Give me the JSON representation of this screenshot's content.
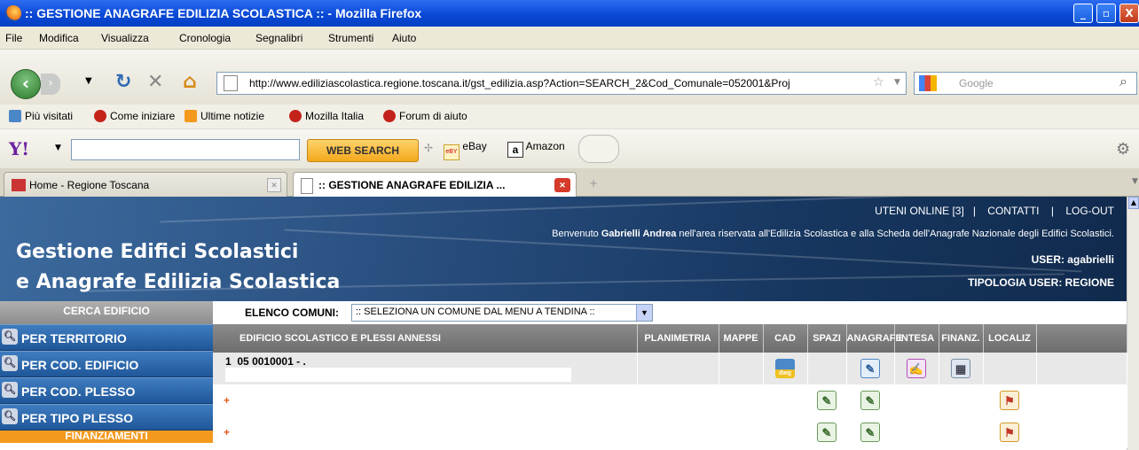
{
  "window": {
    "title": ":: GESTIONE ANAGRAFE EDILIZIA SCOLASTICA :: - Mozilla Firefox",
    "controls": [
      "_",
      "▫",
      "X"
    ]
  },
  "menu": [
    "File",
    "Modifica",
    "Visualizza",
    "Cronologia",
    "Segnalibri",
    "Strumenti",
    "Aiuto"
  ],
  "nav": {
    "url": "http://www.ediliziascolastica.regione.toscana.it/gst_edilizia.asp?Action=SEARCH_2&Cod_Comunale=052001&Proj",
    "search_placeholder": "Google"
  },
  "bookmarks": [
    "Più visitati",
    "Come iniziare",
    "Ultime notizie",
    "Mozilla Italia",
    "Forum di aiuto"
  ],
  "yahoo": {
    "logo": "Y!",
    "button": "WEB SEARCH",
    "ebay": "eBay",
    "amazon": "Amazon"
  },
  "tabs": [
    {
      "label": "Home - Regione Toscana",
      "active": false
    },
    {
      "label": ":: GESTIONE ANAGRAFE EDILIZIA ...",
      "active": true
    }
  ],
  "header": {
    "brand_line1": "Gestione Edifici Scolastici",
    "brand_line2": "e Anagrafe Edilizia Scolastica",
    "links": {
      "online": "UTENI ONLINE [3]",
      "sep": "|",
      "contatti": "CONTATTI",
      "logout": "LOG-OUT"
    },
    "welcome_pre": "Benvenuto ",
    "welcome_user": "Gabrielli Andrea",
    "welcome_post": " nell'area riservata all'Edilizia Scolastica e alla Scheda dell'Anagrafe Nazionale degli Edifici Scolastici.",
    "user": "USER: agabrielli",
    "user_type": "TIPOLOGIA USER: REGIONE"
  },
  "sidebar": {
    "title": "CERCA EDIFICIO",
    "items": [
      "PER TERRITORIO",
      "PER COD. EDIFICIO",
      "PER COD. PLESSO",
      "PER TIPO PLESSO"
    ],
    "footer": "FINANZIAMENTI"
  },
  "comuni": {
    "label": "ELENCO COMUNI:",
    "selected": ":: SELEZIONA UN COMUNE DAL MENU A TENDINA ::"
  },
  "table": {
    "headers": [
      "EDIFICIO SCOLASTICO E PLESSI ANNESSI",
      "PLANIMETRIA",
      "MAPPE",
      "CAD",
      "SPAZI",
      "ANAGRAFE",
      "INTESA",
      "FINANZ.",
      "LOCALIZ"
    ],
    "rows": [
      {
        "num": "1",
        "code": "05",
        "code2": "0010001 - .",
        "cad": "dwg",
        "anagrafe": "doc2",
        "intesa": "pen",
        "finanz": "calc"
      },
      {
        "prefix": "+",
        "spazi": "doc",
        "anagrafe": "doc",
        "localiz": "map"
      },
      {
        "prefix": "+",
        "spazi": "doc",
        "anagrafe": "doc",
        "localiz": "map"
      }
    ]
  }
}
